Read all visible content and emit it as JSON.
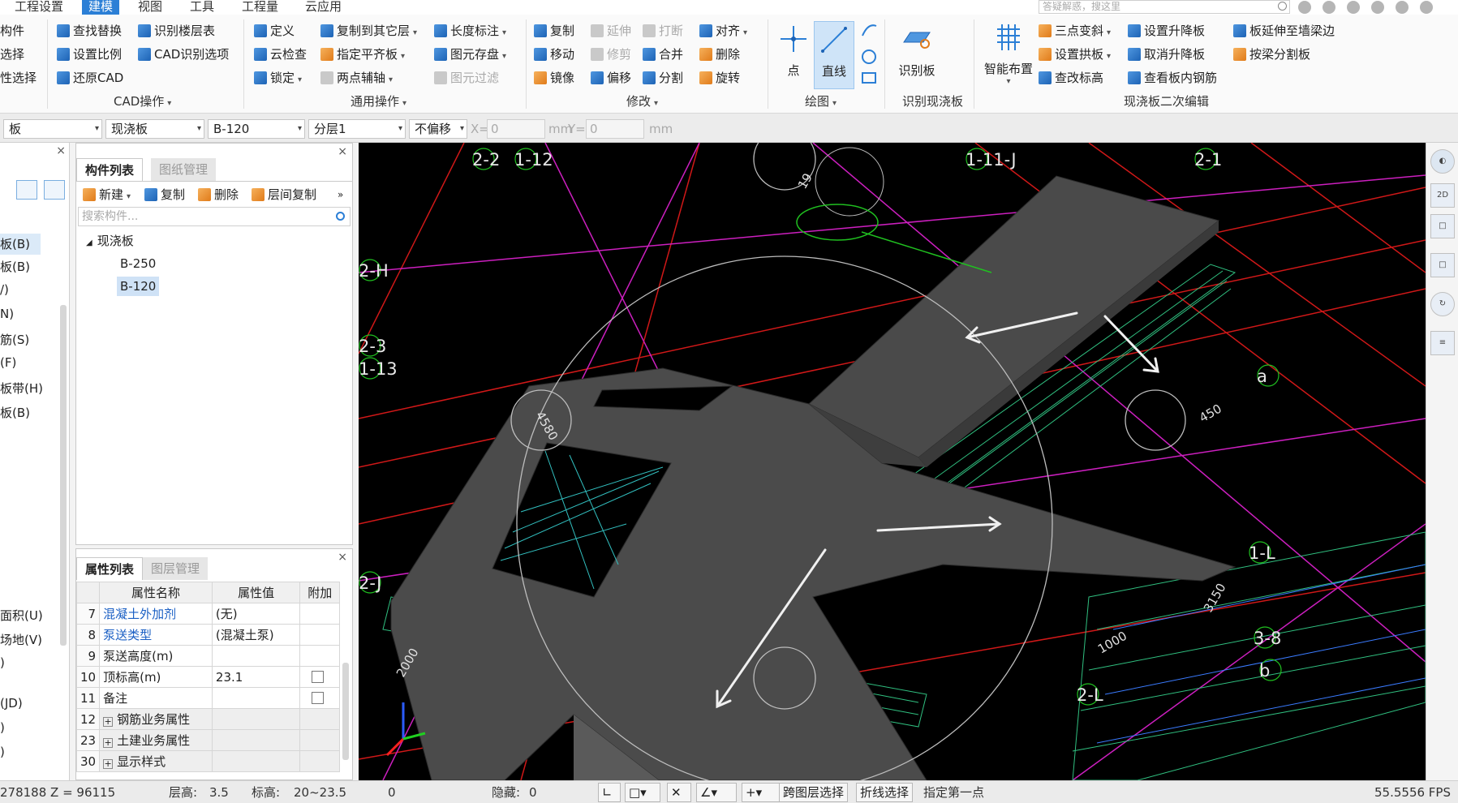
{
  "menu": {
    "items": [
      "工程设置",
      "建模",
      "视图",
      "工具",
      "工程量",
      "云应用"
    ],
    "active": "建模",
    "search_placeholder": "答疑解惑，搜这里"
  },
  "ribbon": {
    "left_cut": [
      "构件",
      "选择",
      "性选择"
    ],
    "cad": {
      "label": "CAD操作",
      "buttons": [
        "查找替换",
        "识别楼层表",
        "设置比例",
        "CAD识别选项",
        "还原CAD"
      ]
    },
    "general": {
      "label": "通用操作",
      "buttons": [
        "定义",
        "复制到其它层",
        "长度标注",
        "云检查",
        "指定平齐板",
        "图元存盘",
        "锁定",
        "两点辅轴",
        "图元过滤"
      ]
    },
    "modify": {
      "label": "修改",
      "buttons": [
        "复制",
        "延伸",
        "打断",
        "对齐",
        "移动",
        "修剪",
        "合并",
        "删除",
        "镜像",
        "偏移",
        "分割",
        "旋转"
      ]
    },
    "draw": {
      "label": "绘图",
      "buttons": [
        "点",
        "直线"
      ]
    },
    "identify": {
      "label": "识别现浇板",
      "buttons": [
        "识别板"
      ]
    },
    "edit": {
      "label": "现浇板二次编辑",
      "buttons": [
        "智能布置",
        "三点变斜",
        "设置升降板",
        "板延伸至墙梁边",
        "设置拱板",
        "取消升降板",
        "按梁分割板",
        "查改标高",
        "查看板内钢筋"
      ]
    }
  },
  "propbar": {
    "type": "板",
    "subtype": "现浇板",
    "component": "B-120",
    "layer": "分层1",
    "offset": "不偏移",
    "x_label": "X=",
    "x_value": "0",
    "x_unit": "mm",
    "y_label": "Y=",
    "y_value": "0",
    "y_unit": "mm"
  },
  "left_nav": {
    "items": [
      "板(B)",
      "板(B)",
      "/)",
      "N)",
      "筋(S)",
      "(F)",
      "板带(H)",
      "板(B)",
      "面积(U)",
      "场地(V)",
      ")",
      "(JD)",
      ")",
      ")"
    ],
    "selected_index": 0
  },
  "component_panel": {
    "tabs": [
      "构件列表",
      "图纸管理"
    ],
    "toolbar": [
      "新建",
      "复制",
      "删除",
      "层间复制"
    ],
    "search_placeholder": "搜索构件...",
    "tree_root": "现浇板",
    "tree_children": [
      "B-250",
      "B-120"
    ],
    "selected": "B-120"
  },
  "property_panel": {
    "tabs": [
      "属性列表",
      "图层管理"
    ],
    "headers": [
      "属性名称",
      "属性值",
      "附加"
    ],
    "rows": [
      {
        "num": "7",
        "name": "混凝土外加剂",
        "value": "(无)",
        "linked": true,
        "check": false,
        "group": false
      },
      {
        "num": "8",
        "name": "泵送类型",
        "value": "(混凝土泵)",
        "linked": true,
        "check": false,
        "group": false
      },
      {
        "num": "9",
        "name": "泵送高度(m)",
        "value": "",
        "linked": false,
        "check": false,
        "group": false
      },
      {
        "num": "10",
        "name": "顶标高(m)",
        "value": "23.1",
        "linked": false,
        "check": true,
        "group": false
      },
      {
        "num": "11",
        "name": "备注",
        "value": "",
        "linked": false,
        "check": true,
        "group": false
      },
      {
        "num": "12",
        "name": "钢筋业务属性",
        "value": "",
        "linked": false,
        "check": false,
        "group": true
      },
      {
        "num": "23",
        "name": "土建业务属性",
        "value": "",
        "linked": false,
        "check": false,
        "group": true
      },
      {
        "num": "30",
        "name": "显示样式",
        "value": "",
        "linked": false,
        "check": false,
        "group": true
      }
    ]
  },
  "viewport": {
    "axis_labels": [
      "2-2",
      "1-12",
      "1-11-J",
      "2-1",
      "2-H",
      "2-3",
      "1-13",
      "a",
      "1-L",
      "2-J",
      "3-8",
      "b",
      "2-L"
    ],
    "dim_labels": [
      "19",
      "450",
      "1000",
      "4580",
      "3150",
      "2000"
    ]
  },
  "statusbar": {
    "coords": "278188 Z = 96115",
    "floor_height_label": "层高:",
    "floor_height": "3.5",
    "elevation_label": "标高:",
    "elevation": "20~23.5",
    "count": "0",
    "hidden_label": "隐藏:",
    "hidden": "0",
    "cross_layer": "跨图层选择",
    "polyline_select": "折线选择",
    "prompt": "指定第一点",
    "fps": "55.5556 FPS"
  },
  "colors": {
    "accent": "#2b7fd6",
    "viewport_bg": "#000000",
    "slab": "#4a4a4a"
  }
}
